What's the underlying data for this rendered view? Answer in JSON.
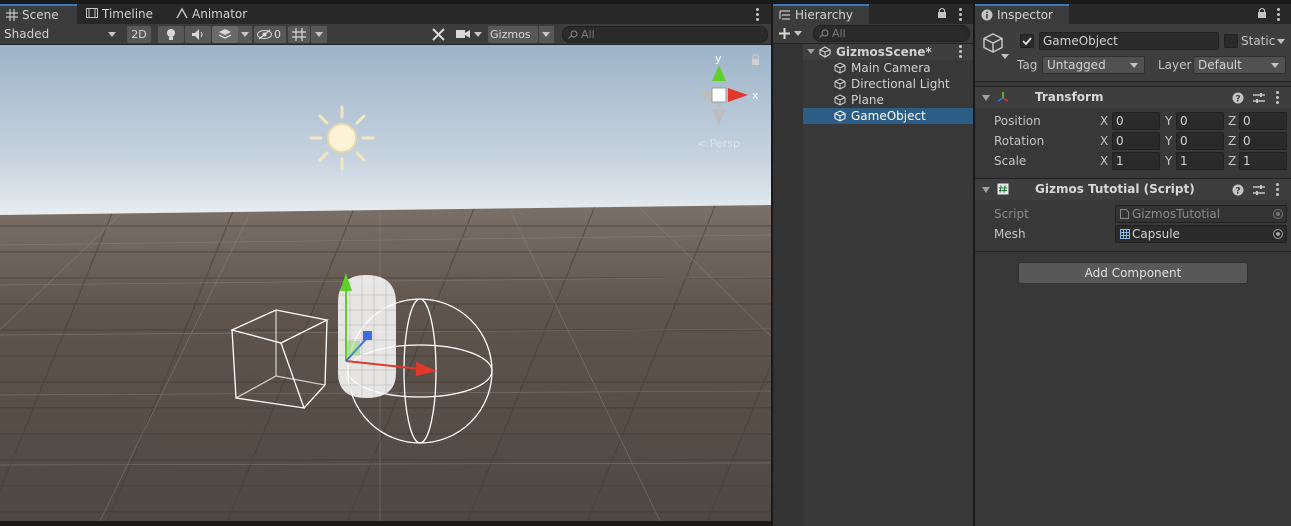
{
  "scene_panel": {
    "tabs": [
      {
        "label": "Scene",
        "icon": "grid-icon",
        "active": true
      },
      {
        "label": "Timeline",
        "icon": "film-icon",
        "active": false
      },
      {
        "label": "Animator",
        "icon": "animator-icon",
        "active": false
      }
    ],
    "toolbar": {
      "draw_mode": "Shaded",
      "mode_2d": "2D",
      "hidden_count": "0",
      "gizmos_label": "Gizmos",
      "search_placeholder": "All"
    },
    "orientation_gizmo": {
      "y_label": "y",
      "x_label": "x",
      "projection_label": "< Persp"
    }
  },
  "hierarchy_panel": {
    "tab_label": "Hierarchy",
    "search_placeholder": "All",
    "scene_name": "GizmosScene*",
    "items": [
      {
        "label": "Main Camera",
        "selected": false
      },
      {
        "label": "Directional Light",
        "selected": false
      },
      {
        "label": "Plane",
        "selected": false
      },
      {
        "label": "GameObject",
        "selected": true
      }
    ]
  },
  "inspector_panel": {
    "tab_label": "Inspector",
    "object_name": "GameObject",
    "static_label": "Static",
    "tag_label": "Tag",
    "tag_value": "Untagged",
    "layer_label": "Layer",
    "layer_value": "Default",
    "transform": {
      "title": "Transform",
      "rows": [
        {
          "label": "Position",
          "x": "0",
          "y": "0",
          "z": "0"
        },
        {
          "label": "Rotation",
          "x": "0",
          "y": "0",
          "z": "0"
        },
        {
          "label": "Scale",
          "x": "1",
          "y": "1",
          "z": "1"
        }
      ],
      "axis_x": "X",
      "axis_y": "Y",
      "axis_z": "Z"
    },
    "script_component": {
      "title": "Gizmos Tutotial (Script)",
      "script_label": "Script",
      "script_value": "GizmosTutotial",
      "mesh_label": "Mesh",
      "mesh_value": "Capsule"
    },
    "add_component_label": "Add Component"
  },
  "colors": {
    "accent_blue": "#3a79bb",
    "selection": "#2c5d87",
    "axis_x": "#e0392b",
    "axis_y": "#5fcf29",
    "axis_z": "#3c6be6"
  }
}
